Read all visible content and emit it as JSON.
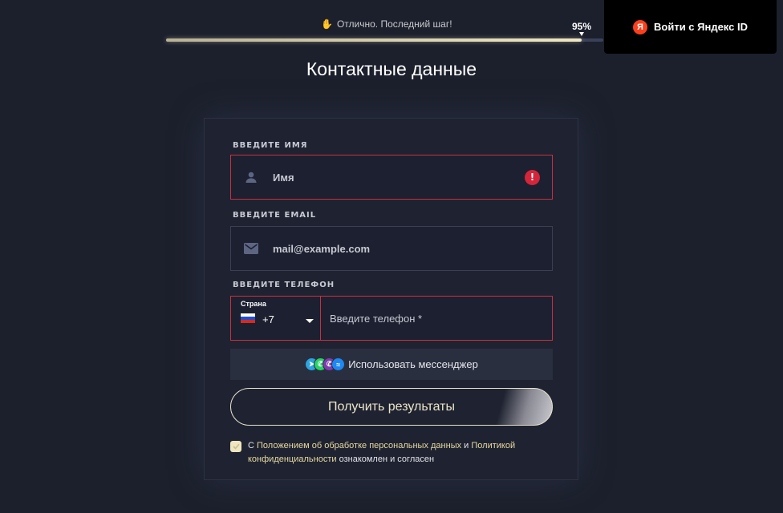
{
  "progress": {
    "label": "Отлично. Последний шаг!",
    "icon": "clapping-hands-icon",
    "percent_text": "95%",
    "percent_value": 95
  },
  "yandex": {
    "logo_letter": "Я",
    "label": "Войти с Яндекс ID"
  },
  "page_title": "Контактные данные",
  "form": {
    "name": {
      "label": "ВВЕДИТЕ ИМЯ",
      "placeholder": "Имя",
      "icon": "user-icon",
      "error_icon": "exclamation-icon",
      "error_glyph": "!"
    },
    "email": {
      "label": "ВВЕДИТЕ EMAIL",
      "placeholder": "mail@example.com",
      "icon": "envelope-icon"
    },
    "phone": {
      "label": "ВВЕДИТЕ ТЕЛЕФОН",
      "country_caption": "Страна",
      "dial_code": "+7",
      "placeholder": "Введите телефон *"
    },
    "messenger_button": "Использовать мессенджер",
    "submit_button": "Получить результаты",
    "consent": {
      "prefix": "С ",
      "link1": "Положением об обработке персональных данных",
      "middle": " и ",
      "link2": "Политикой конфиденциальности",
      "suffix": " ознакомлен и согласен",
      "checked": true
    }
  },
  "colors": {
    "background": "#1c202c",
    "error": "#c9303f",
    "accent": "#efe5bf"
  }
}
